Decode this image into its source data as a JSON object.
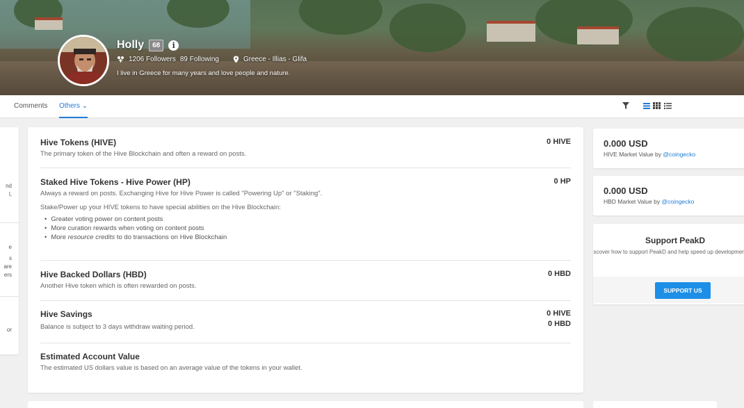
{
  "profile": {
    "name": "Holly",
    "reputation": "68",
    "followers": "1206 Followers",
    "following": "89 Following",
    "location": "Greece - Illias - Glifa",
    "bio": "I live in Greece for many years and love people and nature."
  },
  "tabs": {
    "comments": "Comments",
    "others": "Others ⌄"
  },
  "left_fragments": [
    "nd",
    "l,",
    "e",
    "s",
    "are",
    "ers",
    "or"
  ],
  "wallet": {
    "hive": {
      "title": "Hive Tokens (HIVE)",
      "description": "The primary token of the Hive Blockchain and often a reward on posts.",
      "amount": "0 HIVE"
    },
    "hp": {
      "title": "Staked Hive Tokens - Hive Power (HP)",
      "description": "Always a reward on posts. Exchanging Hive for Hive Power is called \"Powering Up\" or \"Staking\".",
      "description2": "Stake/Power up your HIVE tokens to have special abilities on the Hive Blockchain:",
      "bullets": [
        "Greater voting power on content posts",
        "More curation rewards when voting on content posts"
      ],
      "bullet3_prefix": "More ",
      "bullet3_italic": "resource credits",
      "bullet3_suffix": " to do transactions on Hive Blockchain",
      "amount": "0 HP"
    },
    "hbd": {
      "title": "Hive Backed Dollars (HBD)",
      "description": "Another Hive token which is often rewarded on posts.",
      "amount": "0 HBD"
    },
    "savings": {
      "title": "Hive Savings",
      "description": "Balance is subject to 3 days withdraw waiting period.",
      "amount_hive": "0 HIVE",
      "amount_hbd": "0 HBD"
    },
    "estimated": {
      "title": "Estimated Account Value",
      "description": "The estimated US dollars value is based on an average value of the tokens in your wallet."
    }
  },
  "market": {
    "hive_value": "0.000 USD",
    "hive_label": "HIVE Market Value by ",
    "hbd_value": "0.000 USD",
    "hbd_label": "HBD Market Value by ",
    "source": "@coingecko"
  },
  "support": {
    "title": "Support PeakD",
    "description": "Discover how to support PeakD and help speed up development.",
    "button": "SUPPORT US"
  },
  "colors": {
    "accent": "#1d7bd6",
    "button": "#1d8fe6"
  }
}
